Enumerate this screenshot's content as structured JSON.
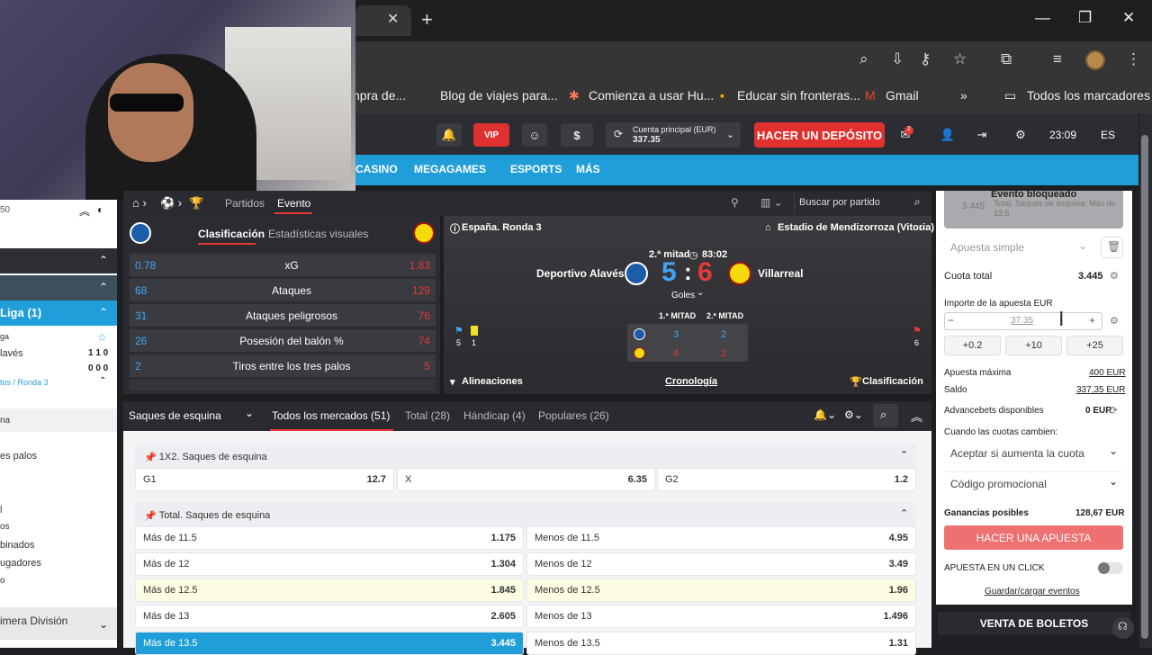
{
  "browser": {
    "tab_close": "✕",
    "new_tab": "+",
    "window_controls": {
      "min": "—",
      "max": "❐",
      "close": "✕"
    },
    "bookmarks": [
      {
        "label": "npra de...",
        "icon": ""
      },
      {
        "label": "Blog de viajes para...",
        "icon": ""
      },
      {
        "label": "Comienza a usar Hu...",
        "icon": "hubspot-icon"
      },
      {
        "label": "Educar sin fronteras...",
        "icon": ""
      },
      {
        "label": "Gmail",
        "icon": "gmail-icon"
      },
      {
        "label": "»",
        "icon": ""
      },
      {
        "label": "Todos los marcadores",
        "icon": "folder-icon"
      }
    ]
  },
  "header": {
    "vip": "VIP",
    "account_label": "Cuenta principal  (EUR)",
    "account_balance": "337.35",
    "deposit": "HACER UN DEPÓSITO",
    "time": "23:09",
    "lang": "ES",
    "badge": "2"
  },
  "nav": [
    "CASINO",
    "MEGAGAMES",
    "ESPORTS",
    "MÁS"
  ],
  "sidebar": {
    "top_num": "50",
    "league": "Liga (1)",
    "team1": "ga",
    "team2": "lavés",
    "score1": "1 1 0",
    "score2": "0 0 0",
    "round": "tos / Ronda 3",
    "items": [
      "na",
      "es palos",
      "",
      "l",
      "os",
      "binados",
      "ugadores",
      "o"
    ],
    "division": "imera División"
  },
  "crumbs": {
    "partidos": "Partidos",
    "evento": "Evento",
    "search": "Buscar por partido"
  },
  "stats": {
    "tab1": "Clasificación",
    "tab2": "Estadísticas visuales",
    "rows": [
      {
        "l": "0.78",
        "name": "xG",
        "r": "1.83"
      },
      {
        "l": "68",
        "name": "Ataques",
        "r": "129"
      },
      {
        "l": "31",
        "name": "Ataques peligrosos",
        "r": "76"
      },
      {
        "l": "26",
        "name": "Posesión del balón %",
        "r": "74"
      },
      {
        "l": "2",
        "name": "Tiros entre los tres palos",
        "r": "5"
      }
    ]
  },
  "match": {
    "league": "España. Ronda 3",
    "stadium": "Estadio de Mendizorroza (Vitoria)",
    "period": "2.ª mitad",
    "clock": "83:02",
    "home": "Deportivo Alavés",
    "away": "Villarreal",
    "home_score": "5",
    "away_score": "6",
    "goals": "Goles",
    "h1": "1.ª MITAD",
    "h2": "2.ª MITAD",
    "home_h1": "3",
    "home_h2": "2",
    "away_h1": "4",
    "away_h2": "2",
    "corner_home": "5",
    "yellow_home": "1",
    "corner_away": "6",
    "lineups": "Alineaciones",
    "timeline": "Cronología",
    "table": "Clasificación"
  },
  "markets": {
    "dropdown": "Saques de esquina",
    "tabs": [
      "Todos los mercados (51)",
      "Total (28)",
      "Hándicap (4)",
      "Populares (26)"
    ],
    "g1_title": "1X2. Saques de esquina",
    "g1": [
      {
        "k": "G1",
        "v": "12.7"
      },
      {
        "k": "X",
        "v": "6.35"
      },
      {
        "k": "G2",
        "v": "1.2"
      }
    ],
    "g2_title": "Total. Saques de esquina",
    "rows": [
      {
        "a": "Más de 11.5",
        "av": "1.175",
        "b": "Menos de 11.5",
        "bv": "4.95"
      },
      {
        "a": "Más de 12",
        "av": "1.304",
        "b": "Menos de 12",
        "bv": "3.49"
      },
      {
        "a": "Más de 12.5",
        "av": "1.845",
        "b": "Menos de 12.5",
        "bv": "1.96"
      },
      {
        "a": "Más de 13",
        "av": "2.605",
        "b": "Menos de 13",
        "bv": "1.496"
      },
      {
        "a": "Más de 13.5",
        "av": "3.445",
        "b": "Menos de 13.5",
        "bv": "1.31"
      }
    ]
  },
  "slip": {
    "blocked": "Evento bloqueado",
    "blocked_sub": "Total. Saques de esquina: Más de 13.5",
    "blocked_odd": "3.445",
    "type": "Apuesta simple",
    "total_odds_label": "Cuota total",
    "total_odds": "3.445",
    "stake_label": "Importe de la apuesta EUR",
    "stake": "37.35",
    "quick": [
      "+0.2",
      "+10",
      "+25"
    ],
    "max_label": "Apuesta máxima",
    "max": "400 EUR",
    "balance_label": "Saldo",
    "balance": "337,35 EUR",
    "adv_label": "Advancebets disponibles",
    "adv": "0 EUR",
    "change_label": "Cuando las cuotas cambien:",
    "change_value": "Aceptar si aumenta la cuota",
    "promo": "Código promocional",
    "win_label": "Ganancias posibles",
    "win": "128,67 EUR",
    "place": "HACER UNA APUESTA",
    "oneclick": "APUESTA EN UN CLICK",
    "saveload": "Guardar/cargar eventos",
    "tickets": "VENTA DE BOLETOS"
  }
}
